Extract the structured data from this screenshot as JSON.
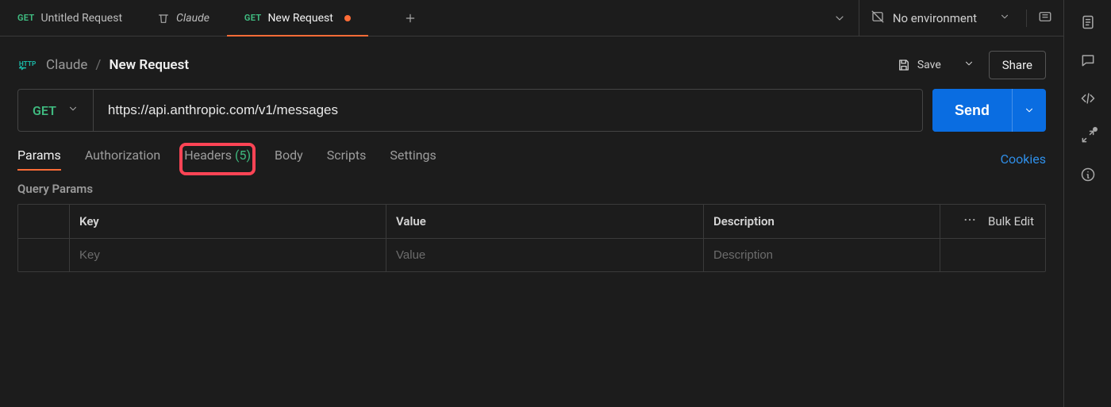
{
  "tabs": [
    {
      "method": "GET",
      "label": "Untitled Request",
      "kind": "http"
    },
    {
      "label": "Claude",
      "kind": "collection",
      "italic": true
    },
    {
      "method": "GET",
      "label": "New Request",
      "kind": "http",
      "dirty": true,
      "active": true
    }
  ],
  "environment": {
    "label": "No environment"
  },
  "breadcrumb": {
    "collection": "Claude",
    "current": "New Request"
  },
  "header_actions": {
    "save_label": "Save",
    "share_label": "Share"
  },
  "request": {
    "method": "GET",
    "url": "https://api.anthropic.com/v1/messages",
    "send_label": "Send"
  },
  "subtabs": {
    "items": [
      {
        "label": "Params",
        "active": true
      },
      {
        "label": "Authorization"
      },
      {
        "label": "Headers",
        "count": "(5)",
        "highlighted": true
      },
      {
        "label": "Body"
      },
      {
        "label": "Scripts"
      },
      {
        "label": "Settings"
      }
    ],
    "cookies_label": "Cookies"
  },
  "params_table": {
    "section_title": "Query Params",
    "header": {
      "key": "Key",
      "value": "Value",
      "description": "Description",
      "bulk_edit": "Bulk Edit"
    },
    "placeholders": {
      "key": "Key",
      "value": "Value",
      "description": "Description"
    }
  }
}
